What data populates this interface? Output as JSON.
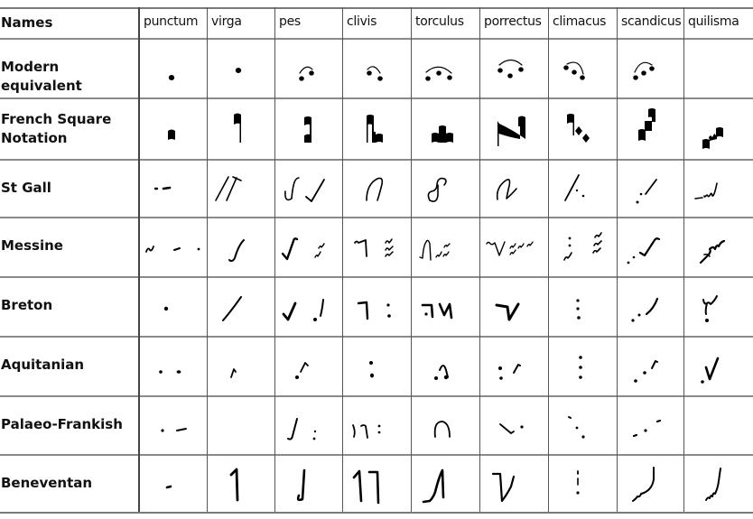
{
  "table": {
    "corner_label": "Names",
    "columns": [
      "punctum",
      "virga",
      "pes",
      "clivis",
      "torculus",
      "porrectus",
      "climacus",
      "scandicus",
      "quilisma"
    ],
    "rows": [
      {
        "label": "Modern equivalent",
        "glyphs": [
          "modern-punctum",
          "modern-virga",
          "modern-pes",
          "modern-clivis",
          "modern-torculus",
          "modern-porrectus",
          "modern-climacus",
          "modern-scandicus",
          ""
        ]
      },
      {
        "label_lines": [
          "French Square",
          "Notation"
        ],
        "glyphs": [
          "square-punctum",
          "square-virga",
          "square-pes",
          "square-clivis",
          "square-torculus",
          "square-porrectus",
          "square-climacus",
          "square-scandicus",
          "square-quilisma"
        ]
      },
      {
        "label": "St Gall",
        "glyphs": [
          "stgall-punctum",
          "stgall-virga",
          "stgall-pes",
          "stgall-clivis",
          "stgall-torculus",
          "stgall-porrectus",
          "stgall-climacus",
          "stgall-scandicus",
          "stgall-quilisma"
        ]
      },
      {
        "label": "Messine",
        "glyphs": [
          "messine-punctum",
          "messine-virga",
          "messine-pes",
          "messine-clivis",
          "messine-torculus",
          "messine-porrectus",
          "messine-climacus",
          "messine-scandicus",
          "messine-quilisma"
        ]
      },
      {
        "label": "Breton",
        "glyphs": [
          "breton-punctum",
          "breton-virga",
          "breton-pes",
          "breton-clivis",
          "breton-torculus",
          "breton-porrectus",
          "breton-climacus",
          "breton-scandicus",
          "breton-quilisma"
        ]
      },
      {
        "label": "Aquitanian",
        "glyphs": [
          "aquitanian-punctum",
          "aquitanian-virga",
          "aquitanian-pes",
          "aquitanian-clivis",
          "aquitanian-torculus",
          "aquitanian-porrectus",
          "aquitanian-climacus",
          "aquitanian-scandicus",
          "aquitanian-quilisma"
        ]
      },
      {
        "label": "Palaeo-Frankish",
        "glyphs": [
          "palaeo-punctum",
          "",
          "palaeo-pes",
          "palaeo-clivis",
          "palaeo-torculus",
          "palaeo-porrectus",
          "palaeo-climacus",
          "palaeo-scandicus",
          ""
        ]
      },
      {
        "label": "Beneventan",
        "glyphs": [
          "beneventan-punctum",
          "beneventan-virga",
          "beneventan-pes",
          "beneventan-clivis",
          "beneventan-torculus",
          "beneventan-porrectus",
          "beneventan-climacus",
          "beneventan-scandicus",
          "beneventan-quilisma"
        ]
      }
    ]
  }
}
